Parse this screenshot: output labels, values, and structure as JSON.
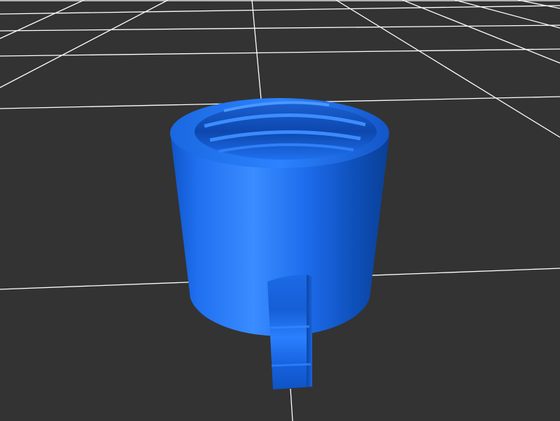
{
  "scene": {
    "model": "cup-with-handle",
    "view": "perspective",
    "grid": true
  },
  "colors": {
    "background": "#333333",
    "grid_line": "#ffffff",
    "model_base": "#1a6fe8",
    "model_highlight": "#3d8eff",
    "model_shadow": "#0a3e95",
    "model_rim": "#1f74f0"
  }
}
